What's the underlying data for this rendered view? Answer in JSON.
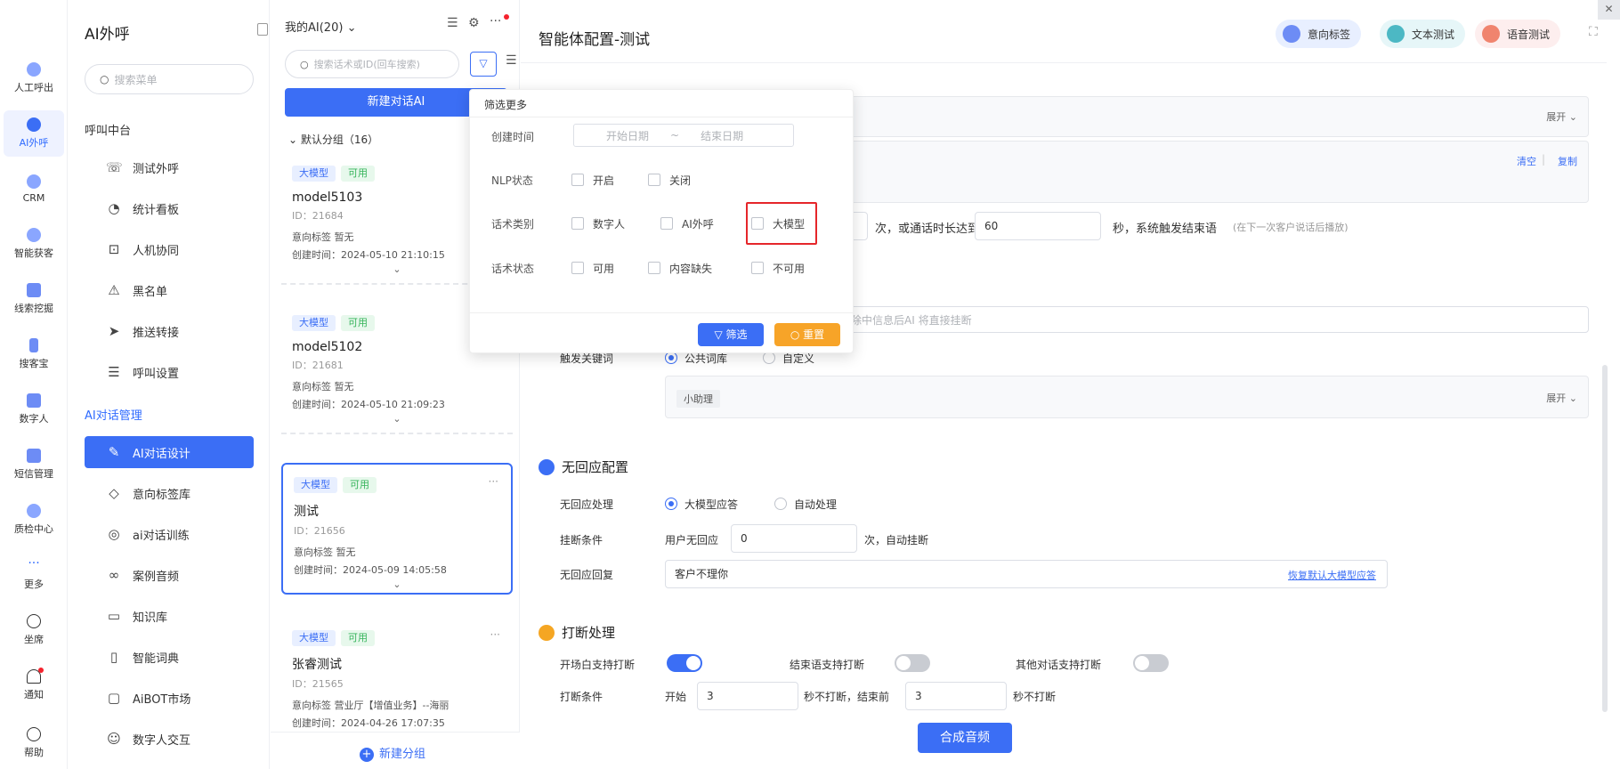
{
  "rail": [
    {
      "label": "人工呼出"
    },
    {
      "label": "AI外呼"
    },
    {
      "label": "CRM"
    },
    {
      "label": "智能获客"
    },
    {
      "label": "线索挖掘"
    },
    {
      "label": "搜客宝"
    },
    {
      "label": "数字人"
    },
    {
      "label": "短信管理"
    },
    {
      "label": "质检中心"
    },
    {
      "label": "更多"
    },
    {
      "label": "坐席"
    },
    {
      "label": "通知"
    },
    {
      "label": "帮助"
    }
  ],
  "menu": {
    "title": "AI外呼",
    "search_placeholder": "搜索菜单",
    "section1": "呼叫中台",
    "items1": [
      {
        "label": "测试外呼",
        "icon": "☏"
      },
      {
        "label": "统计看板",
        "icon": "◔"
      },
      {
        "label": "人机协同",
        "icon": "⊡"
      },
      {
        "label": "黑名单",
        "icon": "⚠"
      },
      {
        "label": "推送转接",
        "icon": "➤"
      },
      {
        "label": "呼叫设置",
        "icon": "☰"
      }
    ],
    "section2": "AI对话管理",
    "items2": [
      {
        "label": "AI对话设计",
        "icon": "✎"
      },
      {
        "label": "意向标签库",
        "icon": "◇"
      },
      {
        "label": "ai对话训练",
        "icon": "◎"
      },
      {
        "label": "案例音频",
        "icon": "∞"
      },
      {
        "label": "知识库",
        "icon": "▭"
      },
      {
        "label": "智能词典",
        "icon": "▯"
      },
      {
        "label": "AiBOT市场",
        "icon": "▢"
      },
      {
        "label": "数字人交互",
        "icon": "☺"
      }
    ]
  },
  "list": {
    "header": "我的AI(20)",
    "search_placeholder": "搜索话术或ID(回车搜索)",
    "new_button": "新建对话AI",
    "group": "默认分组（16）",
    "new_group": "新建分组",
    "cards": [
      {
        "tag1": "大模型",
        "tag2": "可用",
        "name": "model5103",
        "id": "ID：21684",
        "intent": "意向标签   暂无",
        "created": "创建时间：2024-05-10 21:10:15"
      },
      {
        "tag1": "大模型",
        "tag2": "可用",
        "name": "model5102",
        "id": "ID：21681",
        "intent": "意向标签   暂无",
        "created": "创建时间：2024-05-10 21:09:23"
      },
      {
        "tag1": "大模型",
        "tag2": "可用",
        "name": "测试",
        "id": "ID：21656",
        "intent": "意向标签   暂无",
        "created": "创建时间：2024-05-09 14:05:58"
      },
      {
        "tag1": "大模型",
        "tag2": "可用",
        "name": "张睿测试",
        "id": "ID：21565",
        "intent": "意向标签   营业厅【增值业务】--海丽",
        "created": "创建时间：2024-04-26 17:07:35"
      }
    ]
  },
  "main": {
    "title": "智能体配置-测试",
    "header_buttons": [
      {
        "label": "意向标签",
        "color": "#e8efff",
        "dot": "#6d8cf5"
      },
      {
        "label": "文本测试",
        "color": "#e6f6f8",
        "dot": "#4cb8c4"
      },
      {
        "label": "语音测试",
        "color": "#fdeeee",
        "dot": "#f0846e"
      }
    ],
    "expand": "展开",
    "clear": "清空",
    "copy": "复制",
    "end_times_suffix": "次，或通话时长达到",
    "end_duration": "60",
    "end_suffix": "秒，系统触发结束语",
    "end_hint": "(在下一次客户说话后播放)",
    "hangup_placeholder": "除中信息后AI 将直接挂断",
    "trigger_label": "触发关键词",
    "trigger_opt1": "公共词库",
    "trigger_opt2": "自定义",
    "keyword_tag": "小助理",
    "no_reply": {
      "title": "无回应配置",
      "handle_label": "无回应处理",
      "opt1": "大模型应答",
      "opt2": "自动处理",
      "hang_label": "挂断条件",
      "hang_prefix": "用户无回应",
      "hang_value": "0",
      "hang_suffix": "次，自动挂断",
      "reply_label": "无回应回复",
      "reply_value": "客户不理你",
      "restore_link": "恢复默认大模型应答"
    },
    "interrupt": {
      "title": "打断处理",
      "open_label": "开场白支持打断",
      "end_label": "结束语支持打断",
      "other_label": "其他对话支持打断",
      "cond_label": "打断条件",
      "start": "开始",
      "start_value": "3",
      "mid": "秒不打断，结束前",
      "end_value": "3",
      "tail": "秒不打断"
    },
    "synth_button": "合成音频"
  },
  "popover": {
    "title": "筛选更多",
    "created_label": "创建时间",
    "start_placeholder": "开始日期",
    "tilde": "~",
    "end_placeholder": "结束日期",
    "nlp_label": "NLP状态",
    "nlp_opts": [
      "开启",
      "关闭"
    ],
    "type_label": "话术类别",
    "type_opts": [
      "数字人",
      "AI外呼",
      "大模型"
    ],
    "status_label": "话术状态",
    "status_opts": [
      "可用",
      "内容缺失",
      "不可用"
    ],
    "filter_button": "筛选",
    "reset_button": "重置"
  }
}
